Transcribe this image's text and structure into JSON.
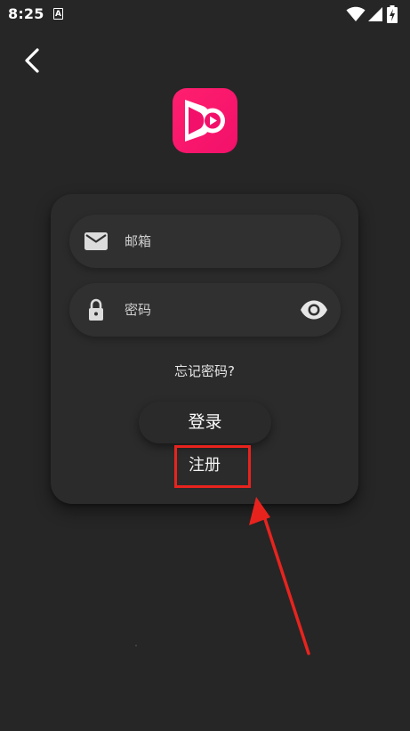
{
  "status_bar": {
    "time": "8:25",
    "notification_glyph": "A",
    "icons": [
      "wifi-icon",
      "signal-icon",
      "battery-charging-icon"
    ]
  },
  "nav": {
    "back_icon": "chevron-left-icon"
  },
  "logo": {
    "icon": "app-play-logo-icon",
    "color": "#f2106a"
  },
  "login_form": {
    "email": {
      "icon": "mail-icon",
      "placeholder": "邮箱",
      "value": ""
    },
    "password": {
      "icon": "lock-icon",
      "placeholder": "密码",
      "value": "",
      "toggle_icon": "eye-icon"
    },
    "forgot_label": "忘记密码?",
    "login_label": "登录",
    "register_label": "注册"
  },
  "annotation": {
    "color": "#e8231e",
    "target": "register-button"
  }
}
